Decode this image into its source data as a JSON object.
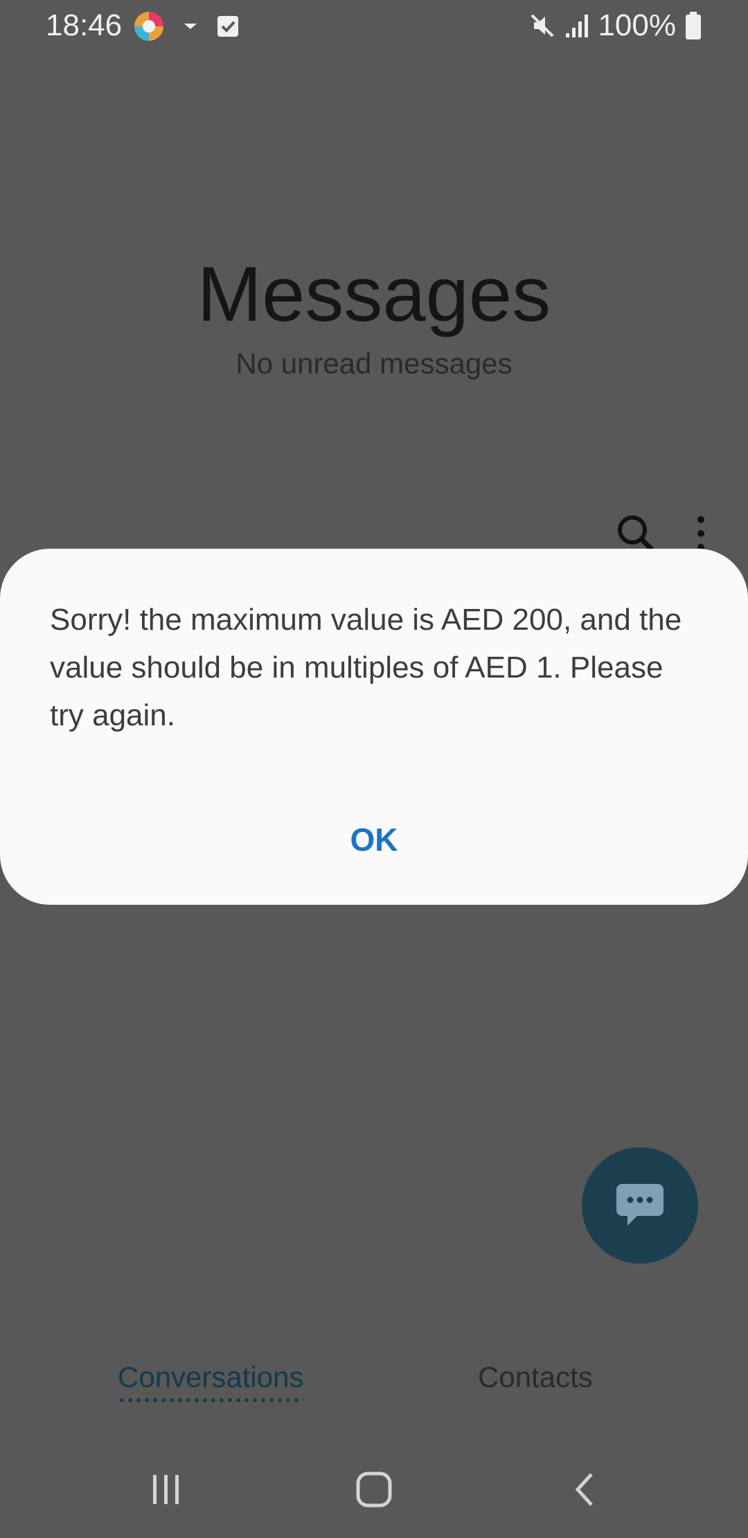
{
  "status_bar": {
    "time": "18:46",
    "battery_text": "100%"
  },
  "header": {
    "title": "Messages",
    "subtitle": "No unread messages"
  },
  "dialog": {
    "message": "Sorry! the maximum value is AED 200, and the value should be in multiples of AED 1. Please try again.",
    "ok_label": "OK"
  },
  "tabs": {
    "conversations_label": "Conversations",
    "contacts_label": "Contacts"
  },
  "icons": {
    "search": "search-icon",
    "more": "more-options-icon",
    "compose": "compose-message-icon",
    "recents": "recent-apps-icon",
    "home": "home-icon",
    "back": "back-icon"
  },
  "colors": {
    "dialog_button": "#1a74c2",
    "fab": "#1c3f50",
    "active_tab": "#15384b"
  }
}
